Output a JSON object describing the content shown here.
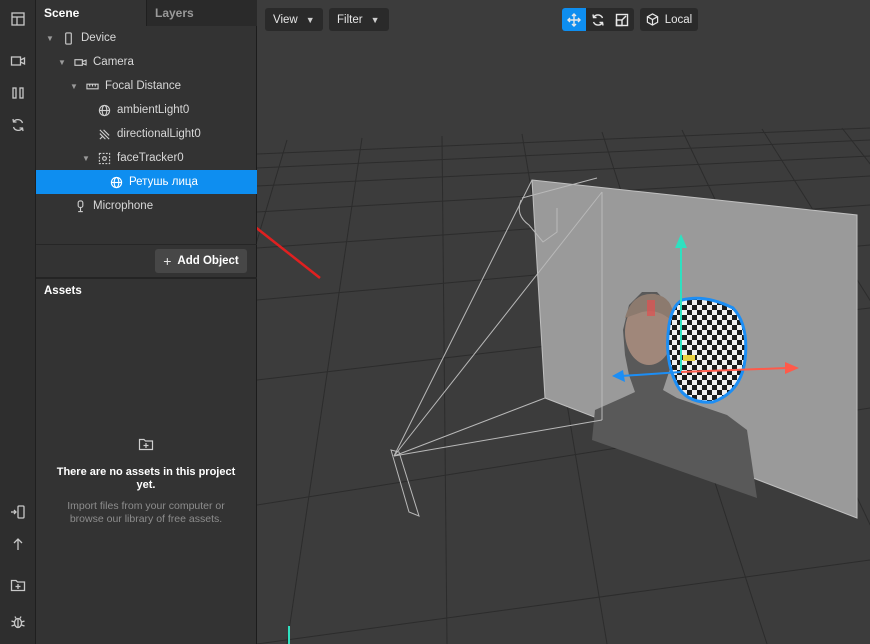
{
  "scene_panel": {
    "tabs": [
      {
        "label": "Scene",
        "active": true
      },
      {
        "label": "Layers",
        "active": false
      }
    ],
    "tree": [
      {
        "label": "Device",
        "icon": "device-icon",
        "expanded": true
      },
      {
        "label": "Camera",
        "icon": "camera-icon",
        "expanded": true
      },
      {
        "label": "Focal Distance",
        "icon": "ruler-icon",
        "expanded": true
      },
      {
        "label": "ambientLight0",
        "icon": "globe-icon"
      },
      {
        "label": "directionalLight0",
        "icon": "directional-light-icon"
      },
      {
        "label": "faceTracker0",
        "icon": "face-tracker-icon",
        "expanded": true
      },
      {
        "label": "Ретушь лица",
        "icon": "globe-icon",
        "selected": true
      },
      {
        "label": "Microphone",
        "icon": "microphone-icon"
      }
    ],
    "add_object_label": "Add Object"
  },
  "assets_panel": {
    "title": "Assets",
    "empty_heading": "There are no assets in this project yet.",
    "empty_desc": "Import files from your computer or browse our library of free assets."
  },
  "viewport_toolbar": {
    "view_label": "View",
    "filter_label": "Filter",
    "tools": [
      "move-icon",
      "rotate-icon",
      "scale-icon"
    ],
    "active_tool": "move-icon",
    "space_label": "Local"
  },
  "colors": {
    "accent": "#0e8ef0",
    "annotation_arrow": "#e02020",
    "axis_x": "#ff5a4a",
    "axis_y": "#2fe0c0",
    "axis_z": "#1c8ef5"
  }
}
